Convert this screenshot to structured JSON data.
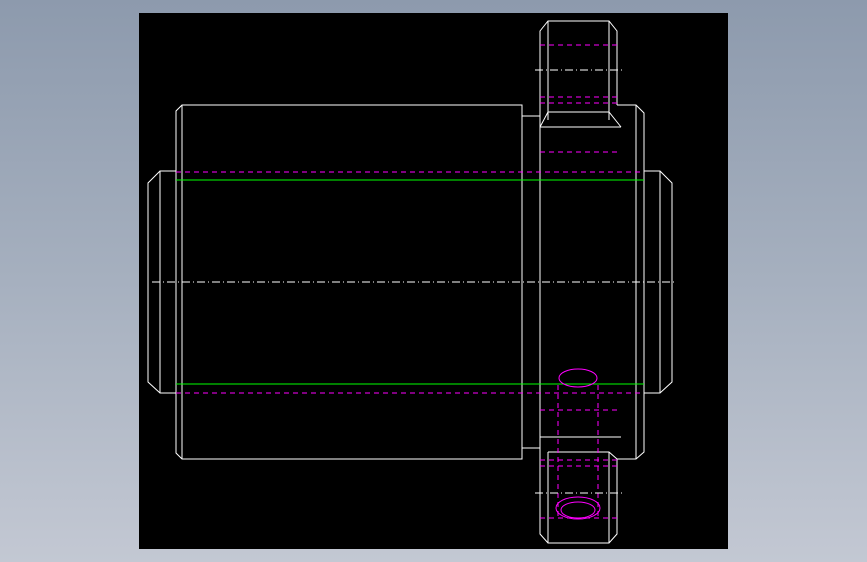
{
  "viewer": {
    "background_color": "#000000",
    "page_gradient": [
      "#8d9aad",
      "#c3c8d3"
    ]
  },
  "colors": {
    "outline": "#ffffff",
    "hidden": "#ff00ff",
    "center": "#ffffff",
    "edge_green": "#00ff00"
  },
  "drawing": {
    "view": "side-view",
    "part": "flanged-cylindrical-nut"
  }
}
